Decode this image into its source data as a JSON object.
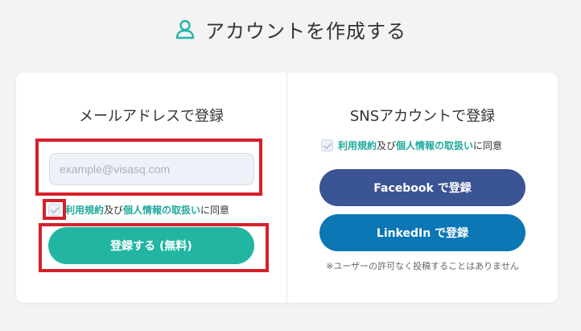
{
  "header": {
    "title": "アカウントを作成する",
    "icon": "user-icon"
  },
  "email_section": {
    "title": "メールアドレスで登録",
    "email_placeholder": "example@visasq.com",
    "email_value": "",
    "consent": {
      "checked": false,
      "terms_link": "利用規約",
      "connector": "及び",
      "privacy_link": "個人情報の取扱い",
      "suffix": "に同意"
    },
    "register_button": "登録する (無料)"
  },
  "sns_section": {
    "title": "SNSアカウントで登録",
    "consent": {
      "checked": false,
      "terms_link": "利用規約",
      "connector": "及び",
      "privacy_link": "個人情報の取扱い",
      "suffix": "に同意"
    },
    "facebook_button": "Facebook で登録",
    "linkedin_button": "LinkedIn で登録",
    "note": "※ユーザーの許可なく投稿することはありません"
  },
  "colors": {
    "accent": "#22b6a2",
    "link": "#1fa99d",
    "facebook": "#3b5493",
    "linkedin": "#0b77b5",
    "highlight": "#d6202b",
    "background": "#f3f3f4"
  }
}
